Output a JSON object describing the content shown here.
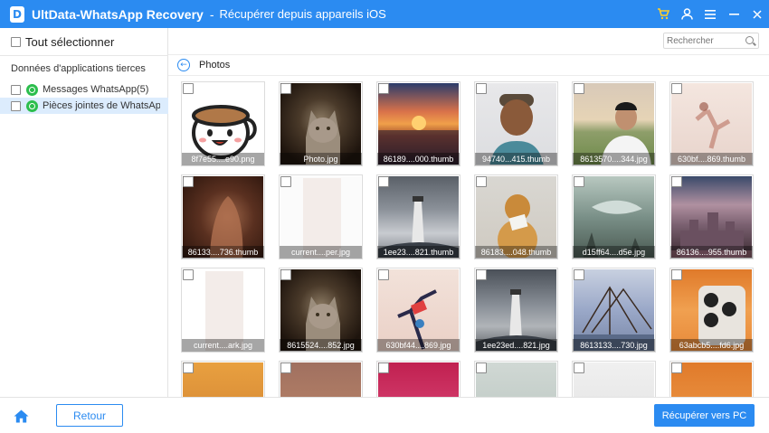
{
  "app": {
    "name": "UltData-WhatsApp Recovery",
    "separator": "-",
    "subtitle": "Récupérer depuis appareils iOS",
    "logo_letter": "D"
  },
  "titlebar_icons": [
    "cart-icon",
    "user-icon",
    "menu-icon",
    "minimize-icon",
    "close-icon"
  ],
  "sidebar": {
    "select_all_label": "Tout sélectionner",
    "section_title": "Données d'applications tierces",
    "items": [
      {
        "label": "Messages WhatsApp(5)",
        "icon": "whatsapp-icon",
        "selected": false
      },
      {
        "label": "Pièces jointes de WhatsApp(...",
        "icon": "whatsapp-icon",
        "selected": true
      }
    ]
  },
  "search": {
    "placeholder": "Rechercher",
    "value": ""
  },
  "folder": {
    "title": "Photos"
  },
  "files": [
    {
      "name": "8f7e55....e90.png",
      "bg": "linear-gradient(#ffffff,#ffffff)",
      "art": "cup"
    },
    {
      "name": "Photo.jpg",
      "bg": "radial-gradient(circle at 50% 45%, #8b7a63 0%, #4a3a2a 35%, #1e140d 80%)",
      "art": "cat"
    },
    {
      "name": "86189....000.thumb",
      "bg": "linear-gradient(180deg,#2b3c6b 0%,#d9724a 35%,#f0a04a 50%,#a04a2a 65%,#2a1a22 100%)",
      "art": "sunset"
    },
    {
      "name": "94740...415.thumb",
      "bg": "linear-gradient(180deg,#e8e8ea 0%,#dcdde0 100%)",
      "art": "person"
    },
    {
      "name": "8613570....344.jpg",
      "bg": "linear-gradient(180deg,#d8c9b8 0%,#e6d4b6 45%,#8e9e6a 60%,#6e8a4a 100%)",
      "art": "man"
    },
    {
      "name": "630bf....869.thumb",
      "bg": "linear-gradient(180deg,#f4e6df 0%,#e8d4cc 100%)",
      "art": "dancer"
    },
    {
      "name": "86133....736.thumb",
      "bg": "radial-gradient(circle at 55% 50%, #a0684a 0%, #5a3020 45%, #2a140c 100%)",
      "art": "back"
    },
    {
      "name": "current....per.jpg",
      "bg": "linear-gradient(180deg,#fbfbfb,#fbfbfb)",
      "art": "blank"
    },
    {
      "name": "1ee23....821.thumb",
      "bg": "linear-gradient(180deg,#5a6068 0%,#8a9098 40%,#c8cbd0 70%,#7a7e84 100%)",
      "art": "lighthouse"
    },
    {
      "name": "86183....048.thumb",
      "bg": "linear-gradient(180deg,#d9d7d2 0%,#cfcac1 100%)",
      "art": "dog"
    },
    {
      "name": "d15ff64....d5e.jpg",
      "bg": "linear-gradient(180deg,#b8c8c0 0%,#7a9088 50%,#4a5a52 100%)",
      "art": "whale"
    },
    {
      "name": "86136....955.thumb",
      "bg": "linear-gradient(180deg,#3a4a6a 0%,#b090a0 35%,#7a6070 60%,#3a2a30 100%)",
      "art": "castle"
    },
    {
      "name": "current....ark.jpg",
      "bg": "linear-gradient(180deg,#ffffff,#ffffff)",
      "art": "blank"
    },
    {
      "name": "8615524....852.jpg",
      "bg": "radial-gradient(circle at 50% 45%, #8b7a63 0%, #4a3a2a 35%, #1e140d 80%)",
      "art": "cat"
    },
    {
      "name": "630bf44....869.jpg",
      "bg": "linear-gradient(180deg,#f2e2da 0%,#ead0c6 100%)",
      "art": "dancer2"
    },
    {
      "name": "1ee23ed....821.jpg",
      "bg": "linear-gradient(180deg,#4a5058 0%,#8a9098 45%,#b0b4b8 70%,#5a5e64 100%)",
      "art": "lighthouse"
    },
    {
      "name": "8613133....730.jpg",
      "bg": "linear-gradient(180deg,#c8d0e0 0%,#9aa8c8 50%,#7a88a8 100%)",
      "art": "nets"
    },
    {
      "name": "63abcb5....fd6.jpg",
      "bg": "linear-gradient(180deg,#e07a2a 0%,#f0a050 50%,#e88a3a 100%)",
      "art": "phone"
    },
    {
      "name": "",
      "bg": "linear-gradient(180deg,#e8a040 0%,#d08030 100%)",
      "art": "none"
    },
    {
      "name": "",
      "bg": "linear-gradient(180deg,#a07060 0%,#c08a6a 100%)",
      "art": "none"
    },
    {
      "name": "",
      "bg": "linear-gradient(180deg,#c02050 0%,#e05080 100%)",
      "art": "none"
    },
    {
      "name": "",
      "bg": "linear-gradient(180deg,#d0d8d4 0%,#b8c4be 100%)",
      "art": "none"
    },
    {
      "name": "",
      "bg": "linear-gradient(180deg,#f0f0f0 0%,#e0e0e0 100%)",
      "art": "none"
    },
    {
      "name": "",
      "bg": "linear-gradient(180deg,#e07a2a 0%,#f0a050 100%)",
      "art": "none"
    }
  ],
  "footer": {
    "back_label": "Retour",
    "recover_label": "Récupérer vers PC"
  },
  "colors": {
    "accent": "#2b8bf1",
    "titlebar": "#2b8bf1",
    "selected_row": "#dcecfd",
    "cart": "#ffce2b",
    "whatsapp": "#2cbe4d"
  }
}
